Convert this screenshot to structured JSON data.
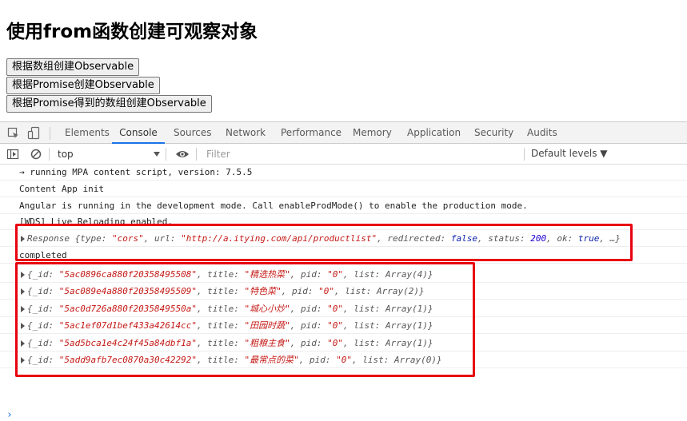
{
  "page": {
    "heading": "使用from函数创建可观察对象",
    "buttons": [
      "根据数组创建Observable",
      "根据Promise创建Observable",
      "根据Promise得到的数组创建Observable"
    ]
  },
  "devtools": {
    "tabs": [
      "Elements",
      "Console",
      "Sources",
      "Network",
      "Performance",
      "Memory",
      "Application",
      "Security",
      "Audits"
    ],
    "active_tab": "Console",
    "context": "top",
    "filter_placeholder": "Filter",
    "levels": "Default levels ▼"
  },
  "console": {
    "logs": [
      "→ running MPA content script, version: 7.5.5",
      "Content App init",
      "Angular is running in the development mode. Call enableProdMode() to enable the production mode.",
      "[WDS] Live Reloading enabled."
    ],
    "response": {
      "prefix": "Response {type: ",
      "type": "\"cors\"",
      "url_key": ", url: ",
      "url": "\"http://a.itying.com/api/productlist\"",
      "redirected_key": ", redirected: ",
      "redirected": "false",
      "status_key": ", status: ",
      "status": "200",
      "ok_key": ", ok: ",
      "ok": "true",
      "suffix": ", …}"
    },
    "completed": "completed",
    "items": [
      {
        "id": "\"5ac0896ca880f20358495508\"",
        "title": "\"精选热菜\"",
        "pid": "\"0\"",
        "list": "Array(4)"
      },
      {
        "id": "\"5ac089e4a880f20358495509\"",
        "title": "\"特色菜\"",
        "pid": "\"0\"",
        "list": "Array(2)"
      },
      {
        "id": "\"5ac0d726a880f2035849550a\"",
        "title": "\"城心小炒\"",
        "pid": "\"0\"",
        "list": "Array(1)"
      },
      {
        "id": "\"5ac1ef07d1bef433a42614cc\"",
        "title": "\"田园时蔬\"",
        "pid": "\"0\"",
        "list": "Array(1)"
      },
      {
        "id": "\"5ad5bca1e4c24f45a84dbf1a\"",
        "title": "\"粗粮主食\"",
        "pid": "\"0\"",
        "list": "Array(1)"
      },
      {
        "id": "\"5add9afb7ec0870a30c42292\"",
        "title": "\"最常点的菜\"",
        "pid": "\"0\"",
        "list": "Array(0)"
      }
    ],
    "labels": {
      "open": "{_id: ",
      "title": ", title: ",
      "pid": ", pid: ",
      "list": ", list: ",
      "close": "}"
    },
    "prompt": "›"
  },
  "colors": {
    "highlight_box": "#e8000e",
    "active_tab_underline": "#1a73e8"
  }
}
